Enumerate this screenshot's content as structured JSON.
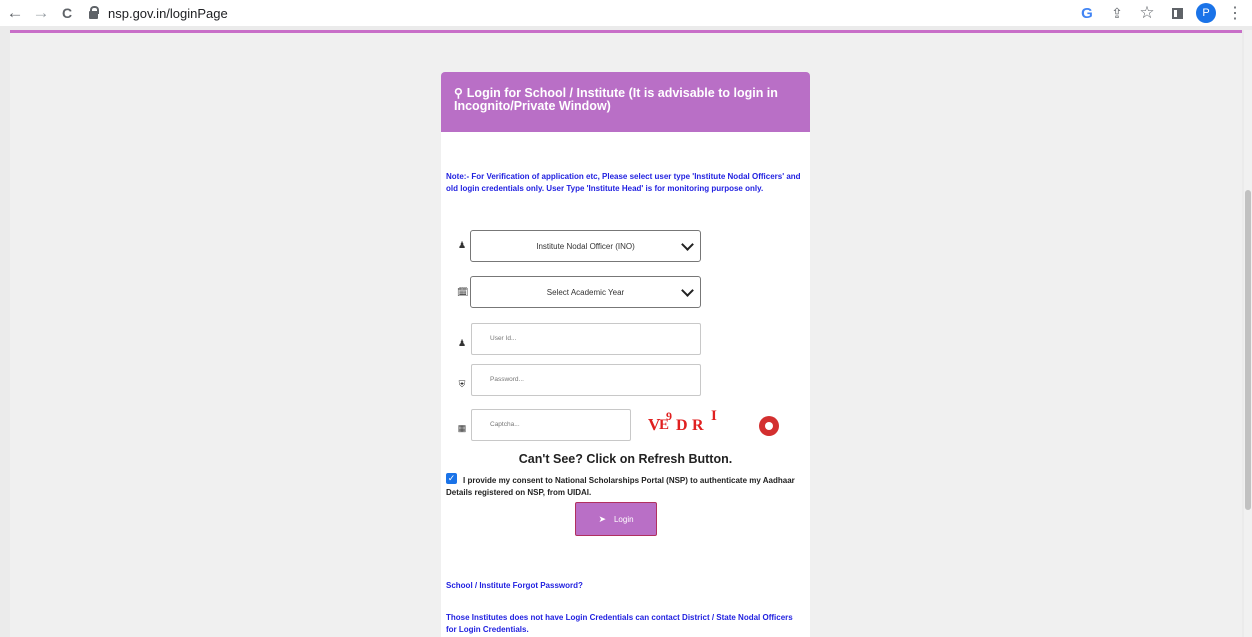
{
  "browser": {
    "back": "←",
    "forward": "→",
    "reload": "C",
    "url": "nsp.gov.in/loginPage",
    "google": "G",
    "share": "⇪",
    "star": "☆",
    "avatar": "P",
    "menu": "⋮"
  },
  "header": {
    "icon": "key-icon",
    "title": "Login for School / Institute (It is advisable to login in Incognito/Private Window)"
  },
  "note": "Note:- For Verification of application etc, Please select user type 'Institute Nodal Officers' and old login credentials only. User Type 'Institute Head' is for monitoring purpose only.",
  "form": {
    "user_type": "Institute Nodal Officer (INO)",
    "academic_year": "Select Academic Year",
    "user_id_placeholder": "User Id...",
    "password_placeholder": "Password...",
    "captcha_placeholder": "Captcha...",
    "captcha_text": "VE9DR I"
  },
  "cant_see": "Can't See? Click on Refresh Button.",
  "consent": "I provide my consent to National Scholarships Portal (NSP) to authenticate my Aadhaar Details registered on NSP, from UIDAI.",
  "login_label": "Login",
  "forgot_password": "School / Institute Forgot Password?",
  "contact_note": "Those Institutes does not have Login Credentials can contact District / State Nodal Officers for Login Credentials.",
  "colors": {
    "accent": "#b96fc6",
    "link": "#1f1fe0",
    "captcha": "#e02020"
  }
}
